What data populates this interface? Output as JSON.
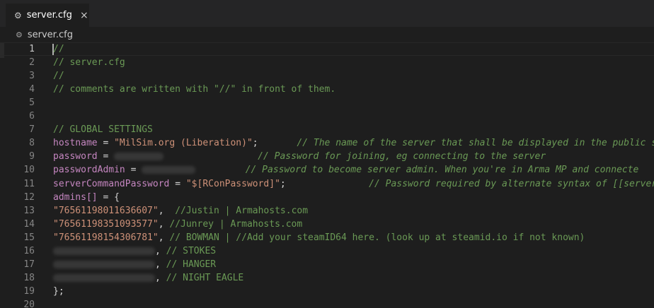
{
  "tab": {
    "title": "server.cfg",
    "icon": "gear-icon",
    "close": "×"
  },
  "breadcrumb": {
    "file": "server.cfg"
  },
  "colors": {
    "comment": "#6a9955",
    "keyword": "#c586c0",
    "string": "#ce9178",
    "text": "#d4d4d4"
  },
  "lines": [
    {
      "num": "1",
      "parts": [
        {
          "c": "comment",
          "t": "//"
        }
      ]
    },
    {
      "num": "2",
      "parts": [
        {
          "c": "comment",
          "t": "// server.cfg"
        }
      ]
    },
    {
      "num": "3",
      "parts": [
        {
          "c": "comment",
          "t": "//"
        }
      ]
    },
    {
      "num": "4",
      "parts": [
        {
          "c": "comment",
          "t": "// comments are written with \"//\" in front of them."
        }
      ]
    },
    {
      "num": "5",
      "parts": []
    },
    {
      "num": "6",
      "parts": []
    },
    {
      "num": "7",
      "parts": [
        {
          "c": "comment",
          "t": "// GLOBAL SETTINGS"
        }
      ]
    },
    {
      "num": "8",
      "parts": [
        {
          "c": "key",
          "t": "hostname"
        },
        {
          "c": "def",
          "t": " = "
        },
        {
          "c": "str",
          "t": "\"MilSim.org (Liberation)\""
        },
        {
          "c": "def",
          "t": ";       "
        },
        {
          "c": "comment-i",
          "t": "// The name of the server that shall be displayed in the public se"
        }
      ]
    },
    {
      "num": "9",
      "parts": [
        {
          "c": "key",
          "t": "password"
        },
        {
          "c": "def",
          "t": " = "
        },
        {
          "c": "blur",
          "w": 70
        },
        {
          "c": "def",
          "t": "                 "
        },
        {
          "c": "comment-i",
          "t": "// Password for joining, eg connecting to the server"
        }
      ]
    },
    {
      "num": "10",
      "parts": [
        {
          "c": "key",
          "t": "passwordAdmin"
        },
        {
          "c": "def",
          "t": " = "
        },
        {
          "c": "blur",
          "w": 76
        },
        {
          "c": "def",
          "t": "         "
        },
        {
          "c": "comment-i",
          "t": "// Password to become server admin. When you're in Arma MP and connecte"
        }
      ]
    },
    {
      "num": "11",
      "parts": [
        {
          "c": "key",
          "t": "serverCommandPassword"
        },
        {
          "c": "def",
          "t": " = "
        },
        {
          "c": "str",
          "t": "\"$[RConPassword]\""
        },
        {
          "c": "def",
          "t": ";               "
        },
        {
          "c": "comment-i",
          "t": "// Password required by alternate syntax of [[serverC"
        }
      ]
    },
    {
      "num": "12",
      "parts": [
        {
          "c": "key",
          "t": "admins[]"
        },
        {
          "c": "def",
          "t": " = {"
        }
      ]
    },
    {
      "num": "13",
      "parts": [
        {
          "c": "str",
          "t": "\"76561198011636607\""
        },
        {
          "c": "def",
          "t": ",  "
        },
        {
          "c": "comment",
          "t": "//Justin | Armahosts.com"
        }
      ]
    },
    {
      "num": "14",
      "parts": [
        {
          "c": "str",
          "t": "\"76561198351093577\""
        },
        {
          "c": "def",
          "t": ", "
        },
        {
          "c": "comment",
          "t": "//Junrey | Armahosts.com"
        }
      ]
    },
    {
      "num": "15",
      "parts": [
        {
          "c": "str",
          "t": "\"76561198154306781\""
        },
        {
          "c": "def",
          "t": ", "
        },
        {
          "c": "comment",
          "t": "// BOWMAN | //Add your steamID64 here. (look up at steamid.io if not known)"
        }
      ]
    },
    {
      "num": "16",
      "parts": [
        {
          "c": "blur",
          "w": 144
        },
        {
          "c": "def",
          "t": ", "
        },
        {
          "c": "comment",
          "t": "// STOKES"
        }
      ]
    },
    {
      "num": "17",
      "parts": [
        {
          "c": "blur",
          "w": 144
        },
        {
          "c": "def",
          "t": ", "
        },
        {
          "c": "comment",
          "t": "// HANGER"
        }
      ]
    },
    {
      "num": "18",
      "parts": [
        {
          "c": "blur",
          "w": 144
        },
        {
          "c": "def",
          "t": ", "
        },
        {
          "c": "comment",
          "t": "// NIGHT EAGLE"
        }
      ]
    },
    {
      "num": "19",
      "parts": [
        {
          "c": "def",
          "t": "};"
        }
      ]
    },
    {
      "num": "20",
      "parts": []
    }
  ]
}
